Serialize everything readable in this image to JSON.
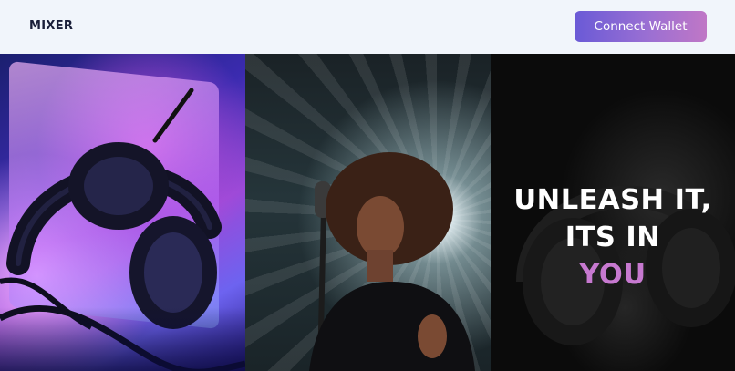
{
  "header": {
    "brand": "MIXER",
    "connect_label": "Connect Wallet"
  },
  "hero": {
    "headline_line1": "UNLEASH IT,",
    "headline_line2": "ITS IN",
    "headline_line3": "YOU"
  },
  "colors": {
    "accent": "#c779d0",
    "button_gradient_start": "#6a5ad6",
    "button_gradient_end": "#c077c6",
    "header_bg": "#f1f5fb",
    "brand_text": "#1a1f3a"
  }
}
